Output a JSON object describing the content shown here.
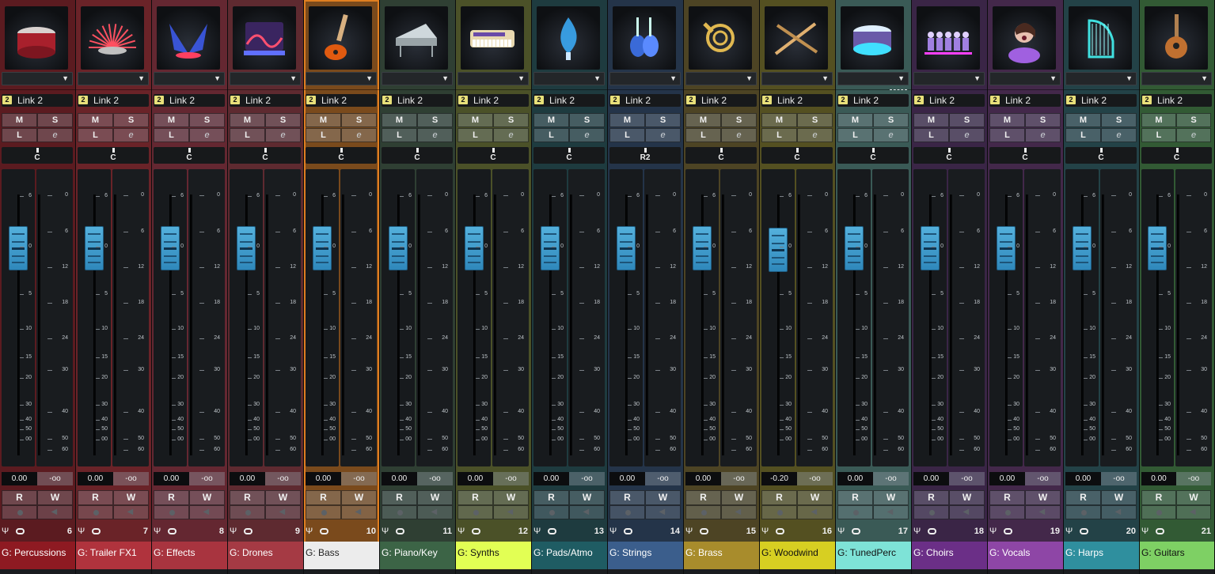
{
  "mixer": {
    "channels": [
      {
        "id": "ch6",
        "name": "G: Percussions",
        "number": "6",
        "link_badge": "2",
        "link": "Link 2",
        "mute": "M",
        "solo": "S",
        "listen": "L",
        "edit": "e",
        "pan": "C",
        "volume": "0.00",
        "peak": "-oo",
        "read": "R",
        "write": "W",
        "color": "#5b1b20",
        "name_bg": "#8e1a22",
        "name_color": "#ffffff",
        "art": "drum-icon",
        "selected": false
      },
      {
        "id": "ch7",
        "name": "G: Trailer FX1",
        "number": "7",
        "link_badge": "2",
        "link": "Link 2",
        "mute": "M",
        "solo": "S",
        "listen": "L",
        "edit": "e",
        "pan": "C",
        "volume": "0.00",
        "peak": "-oo",
        "read": "R",
        "write": "W",
        "color": "#6a2328",
        "name_bg": "#b0333d",
        "name_color": "#ffffff",
        "art": "explosion-icon",
        "selected": false
      },
      {
        "id": "ch8",
        "name": "G: Effects",
        "number": "8",
        "link_badge": "2",
        "link": "Link 2",
        "mute": "M",
        "solo": "S",
        "listen": "L",
        "edit": "e",
        "pan": "C",
        "volume": "0.00",
        "peak": "-oo",
        "read": "R",
        "write": "W",
        "color": "#642731",
        "name_bg": "#a8343f",
        "name_color": "#ffffff",
        "art": "fx-wings-icon",
        "selected": false
      },
      {
        "id": "ch9",
        "name": "G: Drones",
        "number": "9",
        "link_badge": "2",
        "link": "Link 2",
        "mute": "M",
        "solo": "S",
        "listen": "L",
        "edit": "e",
        "pan": "C",
        "volume": "0.00",
        "peak": "-oo",
        "read": "R",
        "write": "W",
        "color": "#5e2a30",
        "name_bg": "#a53a44",
        "name_color": "#ffffff",
        "art": "drone-wave-icon",
        "selected": false
      },
      {
        "id": "ch10",
        "name": "G: Bass",
        "number": "10",
        "link_badge": "2",
        "link": "Link 2",
        "mute": "M",
        "solo": "S",
        "listen": "L",
        "edit": "e",
        "pan": "C",
        "volume": "0.00",
        "peak": "-oo",
        "read": "R",
        "write": "W",
        "color": "#7a4a1c",
        "name_bg": "#ececec",
        "name_color": "#222222",
        "art": "bass-guitar-icon",
        "selected": true
      },
      {
        "id": "ch11",
        "name": "G: Piano/Key",
        "number": "11",
        "link_badge": "2",
        "link": "Link 2",
        "mute": "M",
        "solo": "S",
        "listen": "L",
        "edit": "e",
        "pan": "C",
        "volume": "0.00",
        "peak": "-oo",
        "read": "R",
        "write": "W",
        "color": "#2f3f33",
        "name_bg": "#3c6446",
        "name_color": "#ffffff",
        "art": "grand-piano-icon",
        "selected": false
      },
      {
        "id": "ch12",
        "name": "G: Synths",
        "number": "12",
        "link_badge": "2",
        "link": "Link 2",
        "mute": "M",
        "solo": "S",
        "listen": "L",
        "edit": "e",
        "pan": "C",
        "volume": "0.00",
        "peak": "-oo",
        "read": "R",
        "write": "W",
        "color": "#4b5128",
        "name_bg": "#e2ff54",
        "name_color": "#111111",
        "art": "synth-keyboard-icon",
        "selected": false
      },
      {
        "id": "ch13",
        "name": "G: Pads/Atmo",
        "number": "13",
        "link_badge": "2",
        "link": "Link 2",
        "mute": "M",
        "solo": "S",
        "listen": "L",
        "edit": "e",
        "pan": "C",
        "volume": "0.00",
        "peak": "-oo",
        "read": "R",
        "write": "W",
        "color": "#1e3b3f",
        "name_bg": "#1f5c63",
        "name_color": "#ffffff",
        "art": "blue-flame-icon",
        "selected": false
      },
      {
        "id": "ch14",
        "name": "G: Strings",
        "number": "14",
        "link_badge": "2",
        "link": "Link 2",
        "mute": "M",
        "solo": "S",
        "listen": "L",
        "edit": "e",
        "pan": "R2",
        "volume": "0.00",
        "peak": "-oo",
        "read": "R",
        "write": "W",
        "color": "#243449",
        "name_bg": "#3b5e8c",
        "name_color": "#ffffff",
        "art": "violins-icon",
        "selected": false
      },
      {
        "id": "ch15",
        "name": "G: Brass",
        "number": "15",
        "link_badge": "2",
        "link": "Link 2",
        "mute": "M",
        "solo": "S",
        "listen": "L",
        "edit": "e",
        "pan": "C",
        "volume": "0.00",
        "peak": "-oo",
        "read": "R",
        "write": "W",
        "color": "#4d4424",
        "name_bg": "#a88c2c",
        "name_color": "#ffffff",
        "art": "french-horn-icon",
        "selected": false
      },
      {
        "id": "ch16",
        "name": "G: Woodwind",
        "number": "16",
        "link_badge": "2",
        "link": "Link 2",
        "mute": "M",
        "solo": "S",
        "listen": "L",
        "edit": "e",
        "pan": "C",
        "volume": "-0.20",
        "peak": "-oo",
        "read": "R",
        "write": "W",
        "color": "#545021",
        "name_bg": "#d7cf22",
        "name_color": "#111111",
        "art": "flutes-icon",
        "selected": false
      },
      {
        "id": "ch17",
        "name": "G: TunedPerc",
        "number": "17",
        "link_badge": "2",
        "link": "Link 2",
        "mute": "M",
        "solo": "S",
        "listen": "L",
        "edit": "e",
        "pan": "C",
        "volume": "0.00",
        "peak": "-oo",
        "read": "R",
        "write": "W",
        "color": "#3a5a56",
        "name_bg": "#7ee3d7",
        "name_color": "#111111",
        "art": "tuned-drum-icon",
        "selected": false
      },
      {
        "id": "ch18",
        "name": "G: Choirs",
        "number": "18",
        "link_badge": "2",
        "link": "Link 2",
        "mute": "M",
        "solo": "S",
        "listen": "L",
        "edit": "e",
        "pan": "C",
        "volume": "0.00",
        "peak": "-oo",
        "read": "R",
        "write": "W",
        "color": "#3a2546",
        "name_bg": "#6b2f87",
        "name_color": "#ffffff",
        "art": "choir-icon",
        "selected": false
      },
      {
        "id": "ch19",
        "name": "G: Vocals",
        "number": "19",
        "link_badge": "2",
        "link": "Link 2",
        "mute": "M",
        "solo": "S",
        "listen": "L",
        "edit": "e",
        "pan": "C",
        "volume": "0.00",
        "peak": "-oo",
        "read": "R",
        "write": "W",
        "color": "#43284a",
        "name_bg": "#8e46a6",
        "name_color": "#ffffff",
        "art": "singer-icon",
        "selected": false
      },
      {
        "id": "ch20",
        "name": "G: Harps",
        "number": "20",
        "link_badge": "2",
        "link": "Link 2",
        "mute": "M",
        "solo": "S",
        "listen": "L",
        "edit": "e",
        "pan": "C",
        "volume": "0.00",
        "peak": "-oo",
        "read": "R",
        "write": "W",
        "color": "#234247",
        "name_bg": "#2f8f9e",
        "name_color": "#ffffff",
        "art": "harp-icon",
        "selected": false
      },
      {
        "id": "ch21",
        "name": "G: Guitars",
        "number": "21",
        "link_badge": "2",
        "link": "Link 2",
        "mute": "M",
        "solo": "S",
        "listen": "L",
        "edit": "e",
        "pan": "C",
        "volume": "0.00",
        "peak": "-oo",
        "read": "R",
        "write": "W",
        "color": "#325a34",
        "name_bg": "#7ed064",
        "name_color": "#111111",
        "art": "acoustic-guitar-icon",
        "selected": false
      }
    ],
    "fader_scale": [
      "6",
      "0",
      "5",
      "10",
      "15",
      "20",
      "30",
      "40",
      "50",
      "00"
    ],
    "meter_scale": [
      "0",
      "6",
      "12",
      "18",
      "24",
      "30",
      "40",
      "50",
      "60",
      "00"
    ]
  }
}
